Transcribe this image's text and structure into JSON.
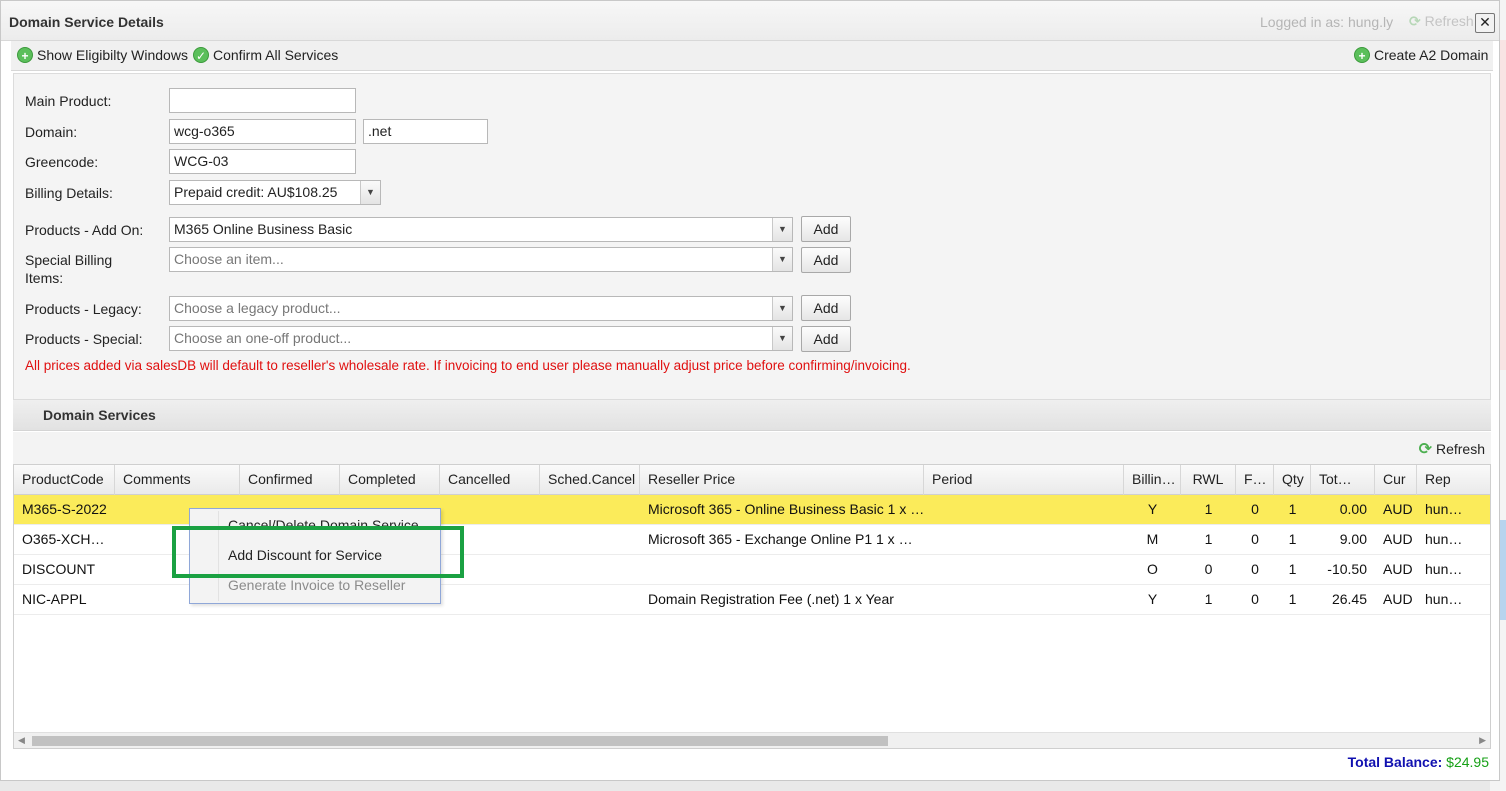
{
  "window": {
    "title": "Domain Service Details",
    "logged_in": "Logged in as: hung.ly",
    "refresh_label": "Refresh",
    "close_symbol": "✕"
  },
  "toolbar": {
    "show_eligibility": "Show Eligibilty Windows",
    "confirm_all": "Confirm All Services",
    "create_a2": "Create A2 Domain"
  },
  "form": {
    "main_product_label": "Main Product:",
    "main_product_value": "",
    "domain_label": "Domain:",
    "domain_value": "wcg-o365",
    "domain_ext": ".net",
    "greencode_label": "Greencode:",
    "greencode_value": "WCG-03",
    "billing_label": "Billing Details:",
    "billing_value": "Prepaid credit: AU$108.25",
    "addon_label": "Products - Add On:",
    "addon_value": "M365 Online Business Basic",
    "special_billing_label_1": "Special Billing",
    "special_billing_label_2": "Items:",
    "special_billing_placeholder": "Choose an item...",
    "legacy_label": "Products - Legacy:",
    "legacy_placeholder": "Choose a legacy product...",
    "special_label": "Products - Special:",
    "special_placeholder": "Choose an one-off product...",
    "add_label": "Add",
    "warning": "All prices added via salesDB will default to reseller's wholesale rate. If invoicing to end user please manually adjust price before confirming/invoicing."
  },
  "services": {
    "title": "Domain Services",
    "refresh_label": "Refresh",
    "columns": [
      "ProductCode",
      "Comments",
      "Confirmed",
      "Completed",
      "Cancelled",
      "Sched.Cancel",
      "Reseller Price",
      "Period",
      "Billin…",
      "RWL",
      "F…",
      "Qty",
      "Tot…",
      "Cur",
      "Rep"
    ],
    "rows": [
      {
        "code": "M365-S-2022",
        "price": "Microsoft 365 - Online Business Basic 1 x …",
        "billing": "Y",
        "rwl": "1",
        "f": "0",
        "qty": "1",
        "total": "0.00",
        "cur": "AUD",
        "rep": "hun…"
      },
      {
        "code": "O365-XCH…",
        "price": "Microsoft 365 - Exchange Online P1 1 x …",
        "billing": "M",
        "rwl": "1",
        "f": "0",
        "qty": "1",
        "total": "9.00",
        "cur": "AUD",
        "rep": "hun…"
      },
      {
        "code": "DISCOUNT",
        "price": "",
        "billing": "O",
        "rwl": "0",
        "f": "0",
        "qty": "1",
        "total": "-10.50",
        "cur": "AUD",
        "rep": "hun…"
      },
      {
        "code": "NIC-APPL",
        "price": "Domain Registration Fee (.net) 1 x Year",
        "billing": "Y",
        "rwl": "1",
        "f": "0",
        "qty": "1",
        "total": "26.45",
        "cur": "AUD",
        "rep": "hun…"
      }
    ],
    "total_label": "Total Balance:",
    "total_value": "$24.95"
  },
  "context_menu": {
    "items": [
      "Cancel/Delete Domain Service",
      "Add Discount for Service",
      "Generate Invoice to Reseller"
    ]
  },
  "colors": {
    "selected_row": "#fbeb5a",
    "highlight_box": "#1aa142",
    "warning_text": "#e01010",
    "total_value": "#16a016"
  }
}
